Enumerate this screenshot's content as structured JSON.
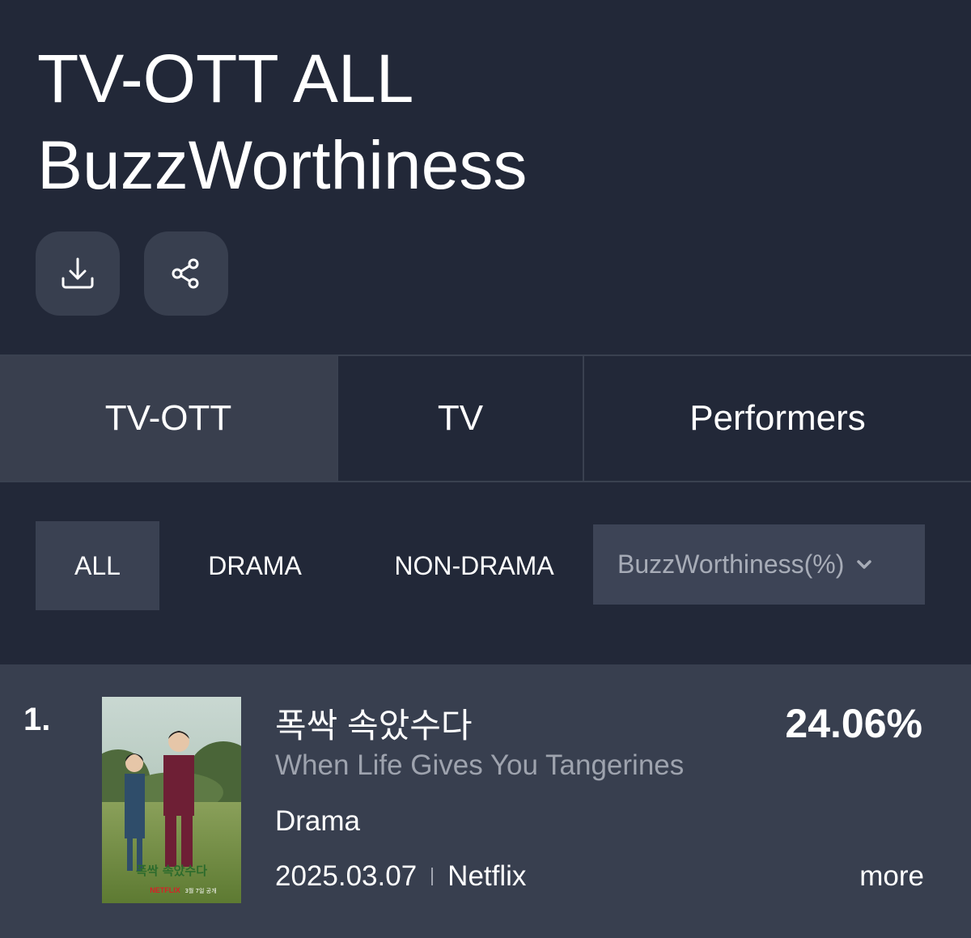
{
  "header": {
    "title_line1": "TV-OTT ALL",
    "title_line2": "BuzzWorthiness",
    "actions": [
      {
        "name": "download",
        "icon": "download-icon"
      },
      {
        "name": "share",
        "icon": "share-icon"
      }
    ]
  },
  "tabs": [
    {
      "label": "TV-OTT",
      "active": true
    },
    {
      "label": "TV",
      "active": false
    },
    {
      "label": "Performers",
      "active": false
    }
  ],
  "filters": {
    "chips": [
      {
        "label": "ALL",
        "active": true
      },
      {
        "label": "DRAMA",
        "active": false
      },
      {
        "label": "NON-DRAMA",
        "active": false
      }
    ],
    "sort_select": {
      "value": "BuzzWorthiness(%)",
      "icon": "chevron-down-icon"
    }
  },
  "ranking": [
    {
      "rank": "1.",
      "title_ko": "폭싹 속았수다",
      "title_en": "When Life Gives You Tangerines",
      "genre": "Drama",
      "date": "2025.03.07",
      "platform": "Netflix",
      "percent": "24.06%",
      "more_label": "more",
      "poster": {
        "title_text": "폭싹 속았수다",
        "brand": "NETFLIX",
        "release_note": "3월 7일 공개"
      }
    }
  ],
  "colors": {
    "background": "#222838",
    "active_tab": "#393f4e",
    "chip_active": "#3a4152",
    "select_bg": "#3d4456",
    "row_bg": "#383f4f",
    "muted_text": "#9ea3ae"
  }
}
